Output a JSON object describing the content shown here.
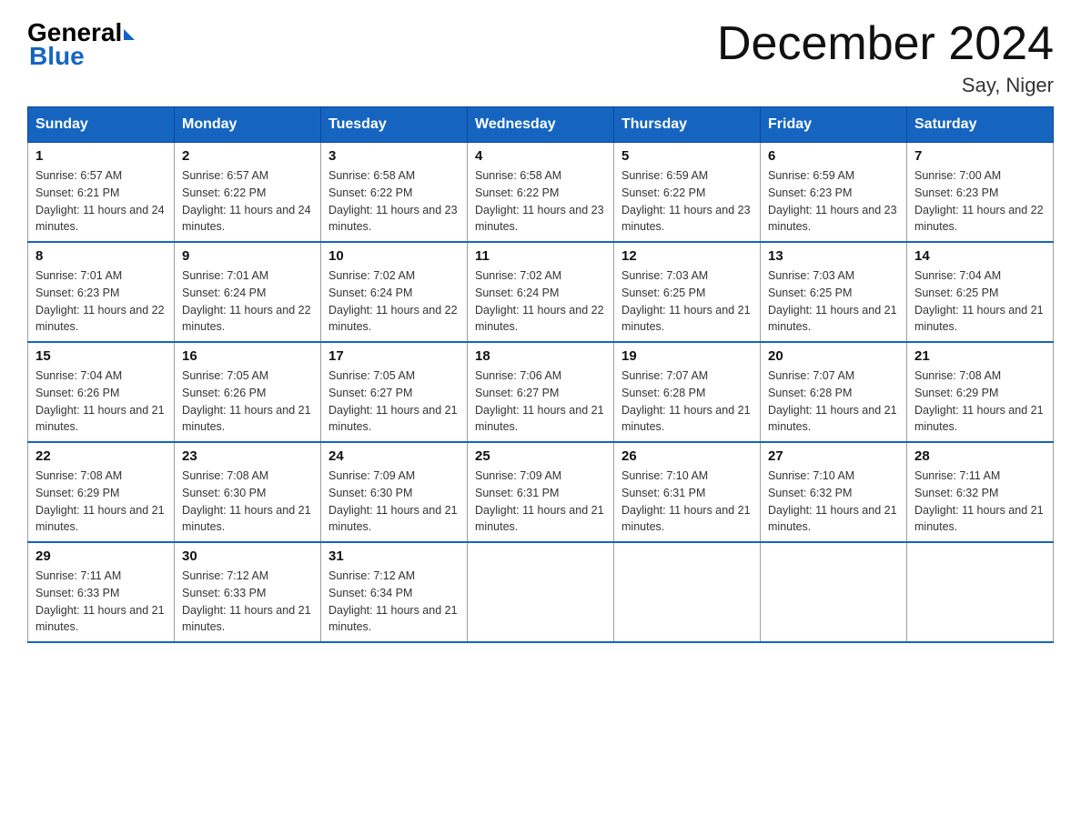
{
  "logo": {
    "general": "General",
    "blue": "Blue",
    "arrow": "▶"
  },
  "title": "December 2024",
  "location": "Say, Niger",
  "days_header": [
    "Sunday",
    "Monday",
    "Tuesday",
    "Wednesday",
    "Thursday",
    "Friday",
    "Saturday"
  ],
  "weeks": [
    [
      {
        "day": "1",
        "sunrise": "Sunrise: 6:57 AM",
        "sunset": "Sunset: 6:21 PM",
        "daylight": "Daylight: 11 hours and 24 minutes."
      },
      {
        "day": "2",
        "sunrise": "Sunrise: 6:57 AM",
        "sunset": "Sunset: 6:22 PM",
        "daylight": "Daylight: 11 hours and 24 minutes."
      },
      {
        "day": "3",
        "sunrise": "Sunrise: 6:58 AM",
        "sunset": "Sunset: 6:22 PM",
        "daylight": "Daylight: 11 hours and 23 minutes."
      },
      {
        "day": "4",
        "sunrise": "Sunrise: 6:58 AM",
        "sunset": "Sunset: 6:22 PM",
        "daylight": "Daylight: 11 hours and 23 minutes."
      },
      {
        "day": "5",
        "sunrise": "Sunrise: 6:59 AM",
        "sunset": "Sunset: 6:22 PM",
        "daylight": "Daylight: 11 hours and 23 minutes."
      },
      {
        "day": "6",
        "sunrise": "Sunrise: 6:59 AM",
        "sunset": "Sunset: 6:23 PM",
        "daylight": "Daylight: 11 hours and 23 minutes."
      },
      {
        "day": "7",
        "sunrise": "Sunrise: 7:00 AM",
        "sunset": "Sunset: 6:23 PM",
        "daylight": "Daylight: 11 hours and 22 minutes."
      }
    ],
    [
      {
        "day": "8",
        "sunrise": "Sunrise: 7:01 AM",
        "sunset": "Sunset: 6:23 PM",
        "daylight": "Daylight: 11 hours and 22 minutes."
      },
      {
        "day": "9",
        "sunrise": "Sunrise: 7:01 AM",
        "sunset": "Sunset: 6:24 PM",
        "daylight": "Daylight: 11 hours and 22 minutes."
      },
      {
        "day": "10",
        "sunrise": "Sunrise: 7:02 AM",
        "sunset": "Sunset: 6:24 PM",
        "daylight": "Daylight: 11 hours and 22 minutes."
      },
      {
        "day": "11",
        "sunrise": "Sunrise: 7:02 AM",
        "sunset": "Sunset: 6:24 PM",
        "daylight": "Daylight: 11 hours and 22 minutes."
      },
      {
        "day": "12",
        "sunrise": "Sunrise: 7:03 AM",
        "sunset": "Sunset: 6:25 PM",
        "daylight": "Daylight: 11 hours and 21 minutes."
      },
      {
        "day": "13",
        "sunrise": "Sunrise: 7:03 AM",
        "sunset": "Sunset: 6:25 PM",
        "daylight": "Daylight: 11 hours and 21 minutes."
      },
      {
        "day": "14",
        "sunrise": "Sunrise: 7:04 AM",
        "sunset": "Sunset: 6:25 PM",
        "daylight": "Daylight: 11 hours and 21 minutes."
      }
    ],
    [
      {
        "day": "15",
        "sunrise": "Sunrise: 7:04 AM",
        "sunset": "Sunset: 6:26 PM",
        "daylight": "Daylight: 11 hours and 21 minutes."
      },
      {
        "day": "16",
        "sunrise": "Sunrise: 7:05 AM",
        "sunset": "Sunset: 6:26 PM",
        "daylight": "Daylight: 11 hours and 21 minutes."
      },
      {
        "day": "17",
        "sunrise": "Sunrise: 7:05 AM",
        "sunset": "Sunset: 6:27 PM",
        "daylight": "Daylight: 11 hours and 21 minutes."
      },
      {
        "day": "18",
        "sunrise": "Sunrise: 7:06 AM",
        "sunset": "Sunset: 6:27 PM",
        "daylight": "Daylight: 11 hours and 21 minutes."
      },
      {
        "day": "19",
        "sunrise": "Sunrise: 7:07 AM",
        "sunset": "Sunset: 6:28 PM",
        "daylight": "Daylight: 11 hours and 21 minutes."
      },
      {
        "day": "20",
        "sunrise": "Sunrise: 7:07 AM",
        "sunset": "Sunset: 6:28 PM",
        "daylight": "Daylight: 11 hours and 21 minutes."
      },
      {
        "day": "21",
        "sunrise": "Sunrise: 7:08 AM",
        "sunset": "Sunset: 6:29 PM",
        "daylight": "Daylight: 11 hours and 21 minutes."
      }
    ],
    [
      {
        "day": "22",
        "sunrise": "Sunrise: 7:08 AM",
        "sunset": "Sunset: 6:29 PM",
        "daylight": "Daylight: 11 hours and 21 minutes."
      },
      {
        "day": "23",
        "sunrise": "Sunrise: 7:08 AM",
        "sunset": "Sunset: 6:30 PM",
        "daylight": "Daylight: 11 hours and 21 minutes."
      },
      {
        "day": "24",
        "sunrise": "Sunrise: 7:09 AM",
        "sunset": "Sunset: 6:30 PM",
        "daylight": "Daylight: 11 hours and 21 minutes."
      },
      {
        "day": "25",
        "sunrise": "Sunrise: 7:09 AM",
        "sunset": "Sunset: 6:31 PM",
        "daylight": "Daylight: 11 hours and 21 minutes."
      },
      {
        "day": "26",
        "sunrise": "Sunrise: 7:10 AM",
        "sunset": "Sunset: 6:31 PM",
        "daylight": "Daylight: 11 hours and 21 minutes."
      },
      {
        "day": "27",
        "sunrise": "Sunrise: 7:10 AM",
        "sunset": "Sunset: 6:32 PM",
        "daylight": "Daylight: 11 hours and 21 minutes."
      },
      {
        "day": "28",
        "sunrise": "Sunrise: 7:11 AM",
        "sunset": "Sunset: 6:32 PM",
        "daylight": "Daylight: 11 hours and 21 minutes."
      }
    ],
    [
      {
        "day": "29",
        "sunrise": "Sunrise: 7:11 AM",
        "sunset": "Sunset: 6:33 PM",
        "daylight": "Daylight: 11 hours and 21 minutes."
      },
      {
        "day": "30",
        "sunrise": "Sunrise: 7:12 AM",
        "sunset": "Sunset: 6:33 PM",
        "daylight": "Daylight: 11 hours and 21 minutes."
      },
      {
        "day": "31",
        "sunrise": "Sunrise: 7:12 AM",
        "sunset": "Sunset: 6:34 PM",
        "daylight": "Daylight: 11 hours and 21 minutes."
      },
      null,
      null,
      null,
      null
    ]
  ]
}
